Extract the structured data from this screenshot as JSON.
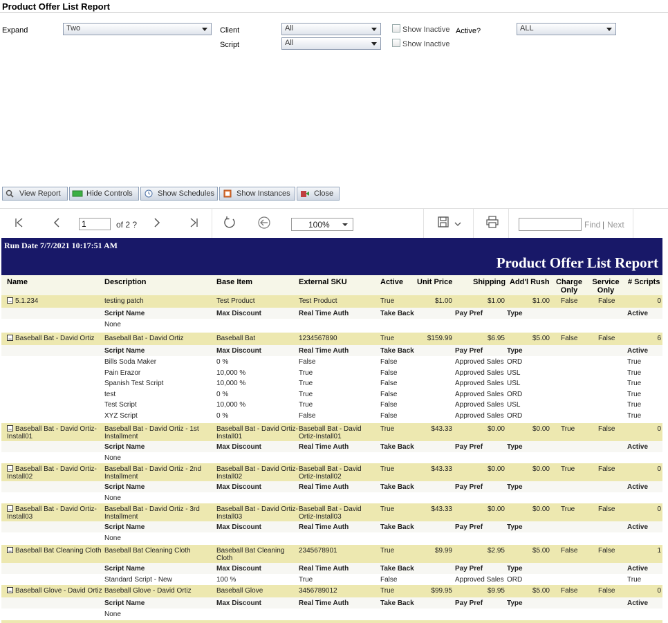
{
  "page": {
    "title": "Product Offer List Report"
  },
  "params": {
    "expand_label": "Expand",
    "expand_value": "Two",
    "client_label": "Client",
    "client_value": "All",
    "script_label": "Script",
    "script_value": "All",
    "show_inactive_1": "Show Inactive",
    "show_inactive_2": "Show Inactive",
    "active_label": "Active?",
    "active_value": "ALL"
  },
  "buttons": {
    "view_report": "View Report",
    "hide_controls": "Hide Controls",
    "show_schedules": "Show Schedules",
    "show_instances": "Show Instances",
    "close": "Close"
  },
  "toolbar": {
    "page": "1",
    "of_pages": "of 2 ?",
    "zoom": "100%",
    "find": "Find",
    "sep": "|",
    "next": "Next"
  },
  "report": {
    "run_date": "Run Date 7/7/2021 10:17:51 AM",
    "title": "Product Offer List Report",
    "columns": [
      "Name",
      "Description",
      "Base Item",
      "External SKU",
      "Active",
      "Unit Price",
      "Shipping",
      "Add'l Rush",
      "Charge Only",
      "Service Only",
      "# Scripts"
    ],
    "sub_columns": [
      "Script Name",
      "Max Discount",
      "Real Time Auth",
      "Take Back",
      "Pay Pref",
      "Type",
      "Active"
    ],
    "none_text": "None",
    "products": [
      {
        "name": "5.1.234",
        "desc": "testing patch",
        "base": "Test Product",
        "sku": "Test Product",
        "active": "True",
        "unit": "$1.00",
        "ship": "$1.00",
        "rush": "$1.00",
        "charge": "False",
        "service": "False",
        "scripts": "0",
        "details": []
      },
      {
        "name": "Baseball Bat - David Ortiz",
        "desc": "Baseball Bat - David Ortiz",
        "base": "Baseball Bat",
        "sku": "1234567890",
        "active": "True",
        "unit": "$159.99",
        "ship": "$6.95",
        "rush": "$5.00",
        "charge": "False",
        "service": "False",
        "scripts": "6",
        "details": [
          [
            "Bills Soda Maker",
            "0 %",
            "False",
            "False",
            "Approved Sales",
            "ORD",
            "True"
          ],
          [
            "Pain Erazor",
            "10,000 %",
            "True",
            "False",
            "Approved Sales",
            "USL",
            "True"
          ],
          [
            "Spanish Test Script",
            "10,000 %",
            "True",
            "False",
            "Approved Sales",
            "USL",
            "True"
          ],
          [
            "test",
            "0 %",
            "True",
            "False",
            "Approved Sales",
            "ORD",
            "True"
          ],
          [
            "Test Script",
            "10,000 %",
            "True",
            "False",
            "Approved Sales",
            "USL",
            "True"
          ],
          [
            "XYZ Script",
            "0 %",
            "False",
            "False",
            "Approved Sales",
            "ORD",
            "True"
          ]
        ]
      },
      {
        "name": "Baseball Bat - David Ortiz-Install01",
        "desc": "Baseball Bat - David Ortiz - 1st Installment",
        "base": "Baseball Bat - David Ortiz-Install01",
        "sku": "Baseball Bat - David Ortiz-Install01",
        "active": "True",
        "unit": "$43.33",
        "ship": "$0.00",
        "rush": "$0.00",
        "charge": "True",
        "service": "False",
        "scripts": "0",
        "details": []
      },
      {
        "name": "Baseball Bat - David Ortiz-Install02",
        "desc": "Baseball Bat - David Ortiz - 2nd Installment",
        "base": "Baseball Bat - David Ortiz-Install02",
        "sku": "Baseball Bat - David Ortiz-Install02",
        "active": "True",
        "unit": "$43.33",
        "ship": "$0.00",
        "rush": "$0.00",
        "charge": "True",
        "service": "False",
        "scripts": "0",
        "details": []
      },
      {
        "name": "Baseball Bat - David Ortiz-Install03",
        "desc": "Baseball Bat - David Ortiz - 3rd Installment",
        "base": "Baseball Bat - David Ortiz-Install03",
        "sku": "Baseball Bat - David Ortiz-Install03",
        "active": "True",
        "unit": "$43.33",
        "ship": "$0.00",
        "rush": "$0.00",
        "charge": "True",
        "service": "False",
        "scripts": "0",
        "details": []
      },
      {
        "name": "Baseball Bat Cleaning Cloth",
        "desc": "Baseball Bat Cleaning Cloth",
        "base": "Baseball Bat Cleaning Cloth",
        "sku": "2345678901",
        "active": "True",
        "unit": "$9.99",
        "ship": "$2.95",
        "rush": "$5.00",
        "charge": "False",
        "service": "False",
        "scripts": "1",
        "details": [
          [
            "Standard Script - New",
            "100 %",
            "True",
            "False",
            "Approved Sales",
            "ORD",
            "True"
          ]
        ]
      },
      {
        "name": "Baseball Glove - David Ortiz",
        "desc": "Baseball Glove - David Ortiz",
        "base": "Baseball Glove",
        "sku": "3456789012",
        "active": "True",
        "unit": "$99.95",
        "ship": "$9.95",
        "rush": "$5.00",
        "charge": "False",
        "service": "False",
        "scripts": "0",
        "details": []
      }
    ]
  }
}
